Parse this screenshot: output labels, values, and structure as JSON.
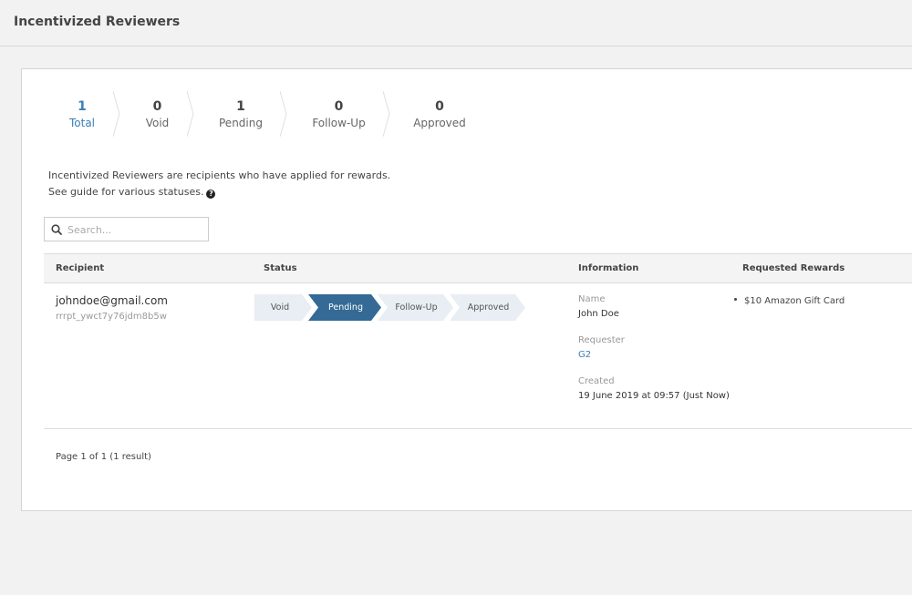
{
  "header": {
    "title": "Incentivized Reviewers"
  },
  "stats": [
    {
      "value": "1",
      "label": "Total",
      "active": true
    },
    {
      "value": "0",
      "label": "Void",
      "active": false
    },
    {
      "value": "1",
      "label": "Pending",
      "active": false
    },
    {
      "value": "0",
      "label": "Follow-Up",
      "active": false
    },
    {
      "value": "0",
      "label": "Approved",
      "active": false
    }
  ],
  "description": {
    "line1": "Incentivized Reviewers are recipients who have applied for rewards.",
    "line2": "See guide for various statuses.",
    "help_icon": "question-circle-icon"
  },
  "search": {
    "placeholder": "Search...",
    "value": "",
    "icon": "search-icon"
  },
  "table": {
    "columns": [
      "Recipient",
      "Status",
      "Information",
      "Requested Rewards"
    ],
    "rows": [
      {
        "email": "johndoe@gmail.com",
        "id": "rrrpt_ywct7y76jdm8b5w",
        "steps": [
          "Void",
          "Pending",
          "Follow-Up",
          "Approved"
        ],
        "current_step": "Pending",
        "info": {
          "name_label": "Name",
          "name": "John Doe",
          "requester_label": "Requester",
          "requester": "G2",
          "created_label": "Created",
          "created": "19 June 2019 at 09:57 (Just Now)"
        },
        "rewards": [
          "$10 Amazon Gift Card"
        ]
      }
    ]
  },
  "pagination": {
    "text": "Page 1 of 1 (1 result)"
  },
  "colors": {
    "accent": "#3b7fb6",
    "step_active": "#346a95",
    "step_inactive": "#e8eef3"
  }
}
